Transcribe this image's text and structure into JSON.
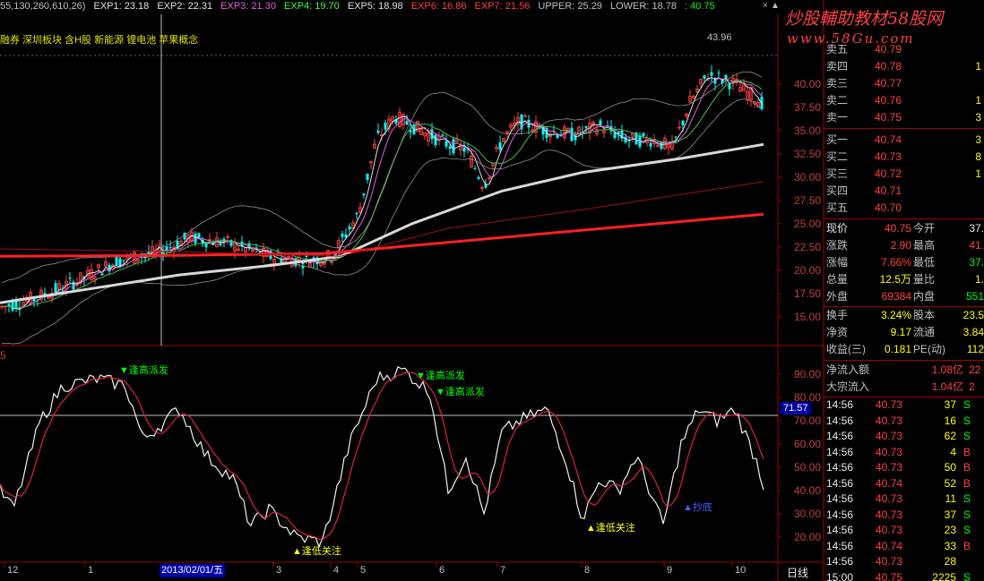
{
  "header": {
    "params": "55,130,260,610,26)",
    "indicators": [
      {
        "label": "EXP1: 23.18",
        "color": "#e0e0e0"
      },
      {
        "label": "EXP2: 22.31",
        "color": "#e0e0e0"
      },
      {
        "label": "EXP3: 21.30",
        "color": "#e060e0"
      },
      {
        "label": "EXP4: 19.70",
        "color": "#40ff40"
      },
      {
        "label": "EXP5: 18.98",
        "color": "#e0e0e0"
      },
      {
        "label": "EXP6: 16.86",
        "color": "#ff4040"
      },
      {
        "label": "EXP7: 21.56",
        "color": "#ff4040"
      },
      {
        "label": "UPPER: 25.29",
        "color": "#c0c0c0"
      },
      {
        "label": "LOWER: 18.78",
        "color": "#c0c0c0"
      },
      {
        "label": ": 40.75",
        "color": "#00ff00"
      }
    ]
  },
  "concepts": "融券 深圳板块 含H股 新能源 锂电池 苹果概念",
  "watermark": {
    "line1": "炒股輔助教材58股网",
    "line2": "www.58Gu.com"
  },
  "chart": {
    "high_label": "43.96",
    "price_axis": [
      "40.00",
      "37.50",
      "35.00",
      "32.50",
      "30.00",
      "27.50",
      "25.00",
      "22.50",
      "20.00",
      "17.50",
      "15.00"
    ],
    "osc_axis": [
      "90.00",
      "80.00",
      "70.00",
      "60.00",
      "50.00",
      "40.00",
      "30.00",
      "20.00"
    ],
    "osc_current": "71.57",
    "osc_id": "5",
    "date_box": "2013/02/01/五",
    "months": [
      "12",
      "1",
      "2",
      "3",
      "4",
      "5",
      "6",
      "7",
      "8",
      "9",
      "10"
    ],
    "period": "日线",
    "signals": [
      {
        "text": "▼逢高派发",
        "color": "#00ff00"
      },
      {
        "text": "▼逢高派发",
        "color": "#00ff00"
      },
      {
        "text": "▼逢高派发",
        "color": "#00ff00"
      },
      {
        "text": "▲逢低关注",
        "color": "#ffff00"
      },
      {
        "text": "▲逢低关注",
        "color": "#ffff00"
      },
      {
        "text": "▲抄底",
        "color": "#4060ff"
      }
    ]
  },
  "orderbook": {
    "asks": [
      {
        "label": "卖五",
        "price": "40.79",
        "vol": ""
      },
      {
        "label": "卖四",
        "price": "40.78",
        "vol": "1"
      },
      {
        "label": "卖三",
        "price": "40.77",
        "vol": ""
      },
      {
        "label": "卖二",
        "price": "40.76",
        "vol": "1"
      },
      {
        "label": "卖一",
        "price": "40.75",
        "vol": "3"
      }
    ],
    "bids": [
      {
        "label": "买一",
        "price": "40.74",
        "vol": "3"
      },
      {
        "label": "买二",
        "price": "40.73",
        "vol": "8"
      },
      {
        "label": "买三",
        "price": "40.72",
        "vol": "1"
      },
      {
        "label": "买四",
        "price": "40.71",
        "vol": ""
      },
      {
        "label": "买五",
        "price": "40.70",
        "vol": ""
      }
    ]
  },
  "quote": {
    "rows": [
      {
        "l1": "现价",
        "v1": "40.75",
        "l2": "今开",
        "v2": "37."
      },
      {
        "l1": "涨跌",
        "v1": "2.90",
        "l2": "最高",
        "v2": "41."
      },
      {
        "l1": "涨幅",
        "v1": "7.66%",
        "l2": "最低",
        "v2": "37."
      },
      {
        "l1": "总量",
        "v1": "12.5万",
        "l2": "量比",
        "v2": "1."
      },
      {
        "l1": "外盘",
        "v1": "69384",
        "l2": "内盘",
        "v2": "551"
      },
      {
        "l1": "换手",
        "v1": "3.24%",
        "l2": "股本",
        "v2": "23.5"
      },
      {
        "l1": "净资",
        "v1": "9.17",
        "l2": "流通",
        "v2": "3.84"
      },
      {
        "l1": "收益(三)",
        "v1": "0.181",
        "l2": "PE(动)",
        "v2": "112"
      }
    ],
    "flow": [
      {
        "label": "净流入额",
        "value": "1.08亿",
        "extra": "22"
      },
      {
        "label": "大宗流入",
        "value": "1.04亿",
        "extra": "2"
      }
    ]
  },
  "ticks": [
    {
      "time": "14:56",
      "price": "40.73",
      "vol": "37",
      "side": "S"
    },
    {
      "time": "14:56",
      "price": "40.73",
      "vol": "16",
      "side": "S"
    },
    {
      "time": "14:56",
      "price": "40.73",
      "vol": "62",
      "side": "S"
    },
    {
      "time": "14:56",
      "price": "40.73",
      "vol": "4",
      "side": "B"
    },
    {
      "time": "14:56",
      "price": "40.73",
      "vol": "50",
      "side": "B"
    },
    {
      "time": "14:56",
      "price": "40.74",
      "vol": "52",
      "side": "B"
    },
    {
      "time": "14:56",
      "price": "40.73",
      "vol": "11",
      "side": "S"
    },
    {
      "time": "14:56",
      "price": "40.73",
      "vol": "37",
      "side": "S"
    },
    {
      "time": "14:56",
      "price": "40.73",
      "vol": "23",
      "side": "S"
    },
    {
      "time": "14:56",
      "price": "40.74",
      "vol": "33",
      "side": "B"
    },
    {
      "time": "14:56",
      "price": "40.73",
      "vol": "28",
      "side": ""
    },
    {
      "time": "15:00",
      "price": "40.75",
      "vol": "2225",
      "side": "S"
    }
  ],
  "colors": {
    "up": "#ff4040",
    "down": "#00ffff",
    "grid": "#800000",
    "panel_border": "#a00000"
  }
}
